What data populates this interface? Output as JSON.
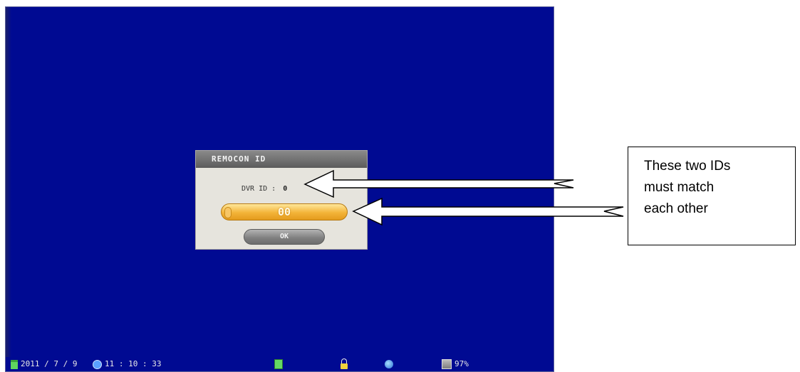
{
  "dialog": {
    "title": "REMOCON ID",
    "dvr_id_label": "DVR ID :",
    "dvr_id_value": "0",
    "remocon_id_value": "00",
    "ok_label": "OK"
  },
  "statusbar": {
    "date": "2011 / 7 / 9",
    "time": "11 : 10 : 33",
    "disk_usage": "97%"
  },
  "callout": {
    "lines": [
      "These two IDs",
      "must match",
      "each other"
    ]
  },
  "colors": {
    "screen_bg": "#000a92",
    "dialog_bg": "#e6e4dd",
    "input_accent": "#f3b338"
  },
  "icons": [
    "calendar-icon",
    "clock-icon",
    "record-disk-icon",
    "lock-icon",
    "network-icon",
    "hdd-icon"
  ]
}
